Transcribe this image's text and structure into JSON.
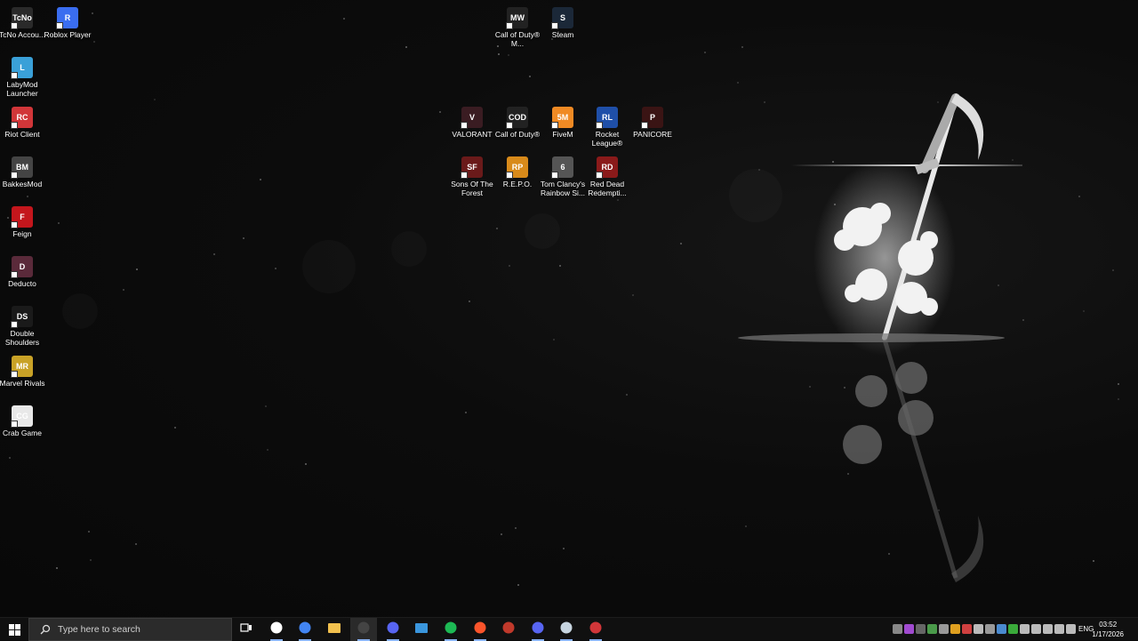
{
  "desktop": {
    "icons": [
      {
        "id": "tcno",
        "label": "TcNo Accou...",
        "color": "#2a2a2a",
        "glyph": "TcNo"
      },
      {
        "id": "roblox",
        "label": "Roblox Player",
        "color": "#3a6df0",
        "glyph": "R"
      },
      {
        "id": "labymod",
        "label": "LabyMod Launcher",
        "color": "#3aa0d8",
        "glyph": "L"
      },
      {
        "id": "riot",
        "label": "Riot Client",
        "color": "#d13639",
        "glyph": "RC"
      },
      {
        "id": "bakkesmod",
        "label": "BakkesMod",
        "color": "#444",
        "glyph": "BM"
      },
      {
        "id": "feign",
        "label": "Feign",
        "color": "#c4161c",
        "glyph": "F"
      },
      {
        "id": "deducto",
        "label": "Deducto",
        "color": "#5a2a3a",
        "glyph": "D"
      },
      {
        "id": "doubleshoulders",
        "label": "Double Shoulders",
        "color": "#1a1a1a",
        "glyph": "DS"
      },
      {
        "id": "marvelrivals",
        "label": "Marvel Rivals",
        "color": "#c9a227",
        "glyph": "MR"
      },
      {
        "id": "crabgame",
        "label": "Crab Game",
        "color": "#e8e8e8",
        "glyph": "CG"
      },
      {
        "id": "codmw",
        "label": "Call of Duty® M...",
        "color": "#222",
        "glyph": "MW"
      },
      {
        "id": "steam",
        "label": "Steam",
        "color": "#1b2838",
        "glyph": "S"
      },
      {
        "id": "valorant",
        "label": "VALORANT",
        "color": "#3a1c22",
        "glyph": "V"
      },
      {
        "id": "cod",
        "label": "Call of Duty®",
        "color": "#222",
        "glyph": "COD"
      },
      {
        "id": "fivem",
        "label": "FiveM",
        "color": "#f08a24",
        "glyph": "5M"
      },
      {
        "id": "rocketleague",
        "label": "Rocket League®",
        "color": "#1f4fa8",
        "glyph": "RL"
      },
      {
        "id": "panicore",
        "label": "PANICORE",
        "color": "#3a1414",
        "glyph": "P"
      },
      {
        "id": "sonsoftheforest",
        "label": "Sons Of The Forest",
        "color": "#6a1a1a",
        "glyph": "SF"
      },
      {
        "id": "repo",
        "label": "R.E.P.O.",
        "color": "#d88a1a",
        "glyph": "RP"
      },
      {
        "id": "rainbowsix",
        "label": "Tom Clancy's Rainbow Si...",
        "color": "#555",
        "glyph": "6"
      },
      {
        "id": "reddead",
        "label": "Red Dead Redempti...",
        "color": "#8a1a1a",
        "glyph": "RD"
      }
    ]
  },
  "taskbar": {
    "search_placeholder": "Type here to search",
    "apps": [
      {
        "id": "task-view",
        "color": "#ffffff"
      },
      {
        "id": "steelseries",
        "color": "#ffffff"
      },
      {
        "id": "chrome",
        "color": "#4285f4"
      },
      {
        "id": "file-explorer",
        "color": "#f2c14e"
      },
      {
        "id": "obs",
        "color": "#444444"
      },
      {
        "id": "discord-ptb",
        "color": "#5865f2"
      },
      {
        "id": "windows-store",
        "color": "#3a96dd"
      },
      {
        "id": "spotify",
        "color": "#1db954"
      },
      {
        "id": "brave",
        "color": "#fb542b"
      },
      {
        "id": "game-launcher",
        "color": "#c0392b"
      },
      {
        "id": "discord",
        "color": "#5865f2"
      },
      {
        "id": "steam",
        "color": "#c7d5e0"
      },
      {
        "id": "riot",
        "color": "#d13639"
      }
    ],
    "tray_colors": [
      "#888",
      "#a04ad0",
      "#666",
      "#4a9a4a",
      "#999",
      "#e0a020",
      "#d04040",
      "#bbb",
      "#999",
      "#4a8ad0",
      "#3aaa3a",
      "#bbb",
      "#bbb",
      "#bbb",
      "#bbb",
      "#bbb"
    ],
    "language": "ENG",
    "time": "03:52",
    "date": "1/17/2026"
  }
}
